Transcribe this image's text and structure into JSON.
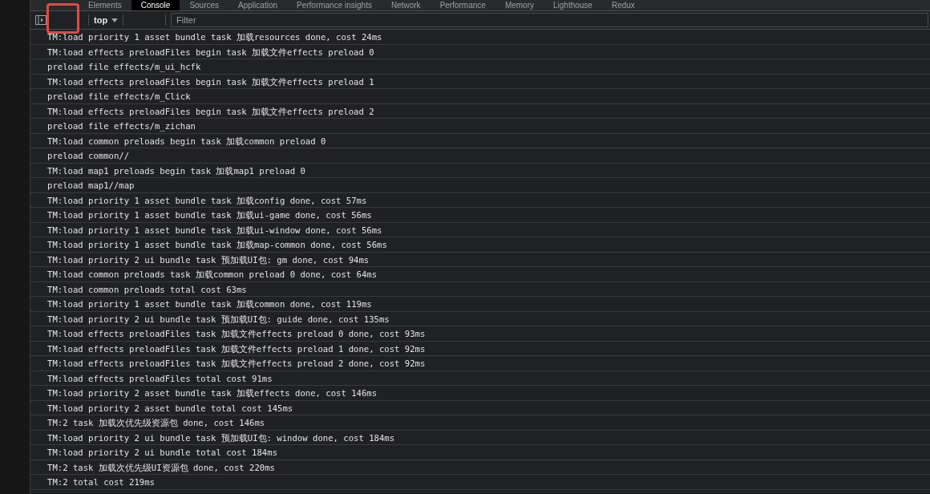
{
  "tabs": [
    {
      "label": "Elements",
      "selected": false
    },
    {
      "label": "Console",
      "selected": true
    },
    {
      "label": "Sources",
      "selected": false
    },
    {
      "label": "Application",
      "selected": false
    },
    {
      "label": "Performance insights",
      "selected": false
    },
    {
      "label": "Network",
      "selected": false
    },
    {
      "label": "Performance",
      "selected": false
    },
    {
      "label": "Memory",
      "selected": false
    },
    {
      "label": "Lighthouse",
      "selected": false
    },
    {
      "label": "Redux",
      "selected": false
    }
  ],
  "toolbar": {
    "context": "top",
    "filter": {
      "placeholder": "Filter"
    }
  },
  "messages": [
    "TM:load priority 1 asset bundle task 加载resources done, cost 24ms",
    "TM:load effects preloadFiles begin task 加载文件effects preload 0",
    "preload file effects/m_ui_hcfk",
    "TM:load effects preloadFiles begin task 加载文件effects preload 1",
    "preload file effects/m_Click",
    "TM:load effects preloadFiles begin task 加载文件effects preload 2",
    "preload file effects/m_zichan",
    "TM:load common preloads begin task 加载common preload 0",
    "preload common//",
    "TM:load map1 preloads begin task 加载map1 preload 0",
    "preload map1//map",
    "TM:load priority 1 asset bundle task 加载config done, cost 57ms",
    "TM:load priority 1 asset bundle task 加载ui-game done, cost 56ms",
    "TM:load priority 1 asset bundle task 加载ui-window done, cost 56ms",
    "TM:load priority 1 asset bundle task 加载map-common done, cost 56ms",
    "TM:load priority 2 ui bundle task 预加载UI包: gm done, cost 94ms",
    "TM:load common preloads task 加载common preload 0 done, cost 64ms",
    "TM:load common preloads total cost 63ms",
    "TM:load priority 1 asset bundle task 加载common done, cost 119ms",
    "TM:load priority 2 ui bundle task 预加载UI包: guide done, cost 135ms",
    "TM:load effects preloadFiles task 加载文件effects preload 0 done, cost 93ms",
    "TM:load effects preloadFiles task 加载文件effects preload 1 done, cost 92ms",
    "TM:load effects preloadFiles task 加载文件effects preload 2 done, cost 92ms",
    "TM:load effects preloadFiles total cost 91ms",
    "TM:load priority 2 asset bundle task 加载effects done, cost 146ms",
    "TM:load priority 2 asset bundle total cost 145ms",
    "TM:2 task 加载次优先级资源包 done, cost 146ms",
    "TM:load priority 2 ui bundle task 预加载UI包: window done, cost 184ms",
    "TM:load priority 2 ui bundle total cost 184ms",
    "TM:2 task 加载次优先级UI资源包 done, cost 220ms",
    "TM:2 total cost 219ms"
  ]
}
